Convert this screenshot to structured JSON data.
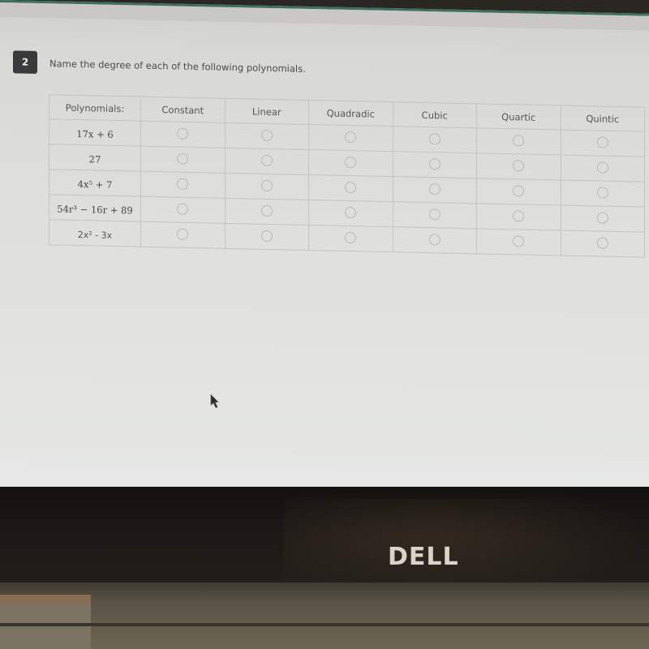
{
  "question": {
    "number": "2",
    "prompt": "Name the degree of each of the following polynomials."
  },
  "table": {
    "headers": [
      "Polynomials:",
      "Constant",
      "Linear",
      "Quadradic",
      "Cubic",
      "Quartic",
      "Quintic"
    ],
    "rows": [
      {
        "polynomial": "17x + 6",
        "style": "math",
        "selected": null
      },
      {
        "polynomial": "27",
        "style": "math",
        "selected": null
      },
      {
        "polynomial": "4x⁵ + 7",
        "style": "math",
        "selected": null
      },
      {
        "polynomial": "54r³ − 16r + 89",
        "style": "math",
        "selected": null
      },
      {
        "polynomial": "2x² - 3x",
        "style": "plain",
        "selected": null
      }
    ]
  },
  "device": {
    "brand_logo": "DELL"
  },
  "icons": {
    "cursor": "mouse-pointer-icon",
    "radio": "radio-button-unselected"
  }
}
